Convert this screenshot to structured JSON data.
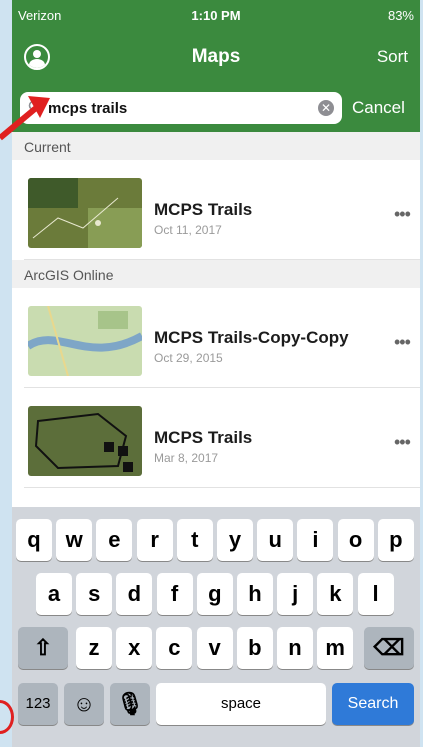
{
  "status": {
    "carrier": "Verizon",
    "time": "1:10 PM",
    "battery": "83%"
  },
  "nav": {
    "title": "Maps",
    "sort_label": "Sort"
  },
  "search": {
    "value": "mcps trails",
    "cancel_label": "Cancel"
  },
  "sections": [
    {
      "header": "Current",
      "items": [
        {
          "title": "MCPS Trails",
          "date": "Oct 11, 2017"
        }
      ]
    },
    {
      "header": "ArcGIS Online",
      "items": [
        {
          "title": "MCPS Trails-Copy-Copy",
          "date": "Oct 29, 2015"
        },
        {
          "title": "MCPS Trails",
          "date": "Mar 8, 2017"
        }
      ]
    }
  ],
  "more_label": "•••",
  "keyboard": {
    "row1": [
      "q",
      "w",
      "e",
      "r",
      "t",
      "y",
      "u",
      "i",
      "o",
      "p"
    ],
    "row2": [
      "a",
      "s",
      "d",
      "f",
      "g",
      "h",
      "j",
      "k",
      "l"
    ],
    "row3": [
      "z",
      "x",
      "c",
      "v",
      "b",
      "n",
      "m"
    ],
    "numbers_label": "123",
    "space_label": "space",
    "search_label": "Search"
  },
  "colors": {
    "accent": "#3b8a3e",
    "keyboard_blue": "#2f7ad8"
  }
}
